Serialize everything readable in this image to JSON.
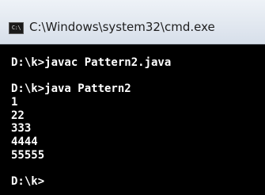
{
  "window": {
    "title": "C:\\Windows\\system32\\cmd.exe",
    "icon_label": "C:\\"
  },
  "console": {
    "lines": [
      "D:\\k>javac Pattern2.java",
      "",
      "D:\\k>java Pattern2",
      "1",
      "22",
      "333",
      "4444",
      "55555",
      "",
      "D:\\k>"
    ]
  }
}
